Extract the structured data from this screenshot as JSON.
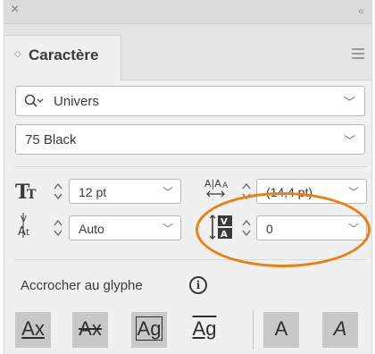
{
  "topbar": {
    "close_glyph": "×",
    "collapse_glyph": "‹‹"
  },
  "panel": {
    "tab_title": "Caractère"
  },
  "font_family": {
    "value": "Univers"
  },
  "font_style": {
    "value": "75 Black"
  },
  "font_size": {
    "value": "12 pt"
  },
  "leading": {
    "value": "(14,4 pt)"
  },
  "kerning": {
    "value": "Auto"
  },
  "tracking": {
    "value": "0"
  },
  "snap": {
    "label": "Accrocher au glyphe",
    "info_glyph": "i",
    "buttons": [
      {
        "glyph": "Ax",
        "selected": true
      },
      {
        "glyph": "Ax",
        "selected": true
      },
      {
        "glyph": "Ag",
        "selected": true
      },
      {
        "glyph": "Ag",
        "selected": false
      },
      {
        "glyph": "A",
        "selected": true
      },
      {
        "glyph": "A",
        "selected": true
      }
    ]
  },
  "colors": {
    "highlight": "#e8811a",
    "panel_bg": "#f0f0f0",
    "selected_button": "#c8c8c8"
  },
  "icons": [
    "close-icon",
    "collapse-icon",
    "panel-menu-icon",
    "search-icon",
    "chevron-down-icon",
    "stepper-icon",
    "font-size-icon",
    "leading-icon",
    "kerning-icon",
    "tracking-icon",
    "info-icon"
  ]
}
